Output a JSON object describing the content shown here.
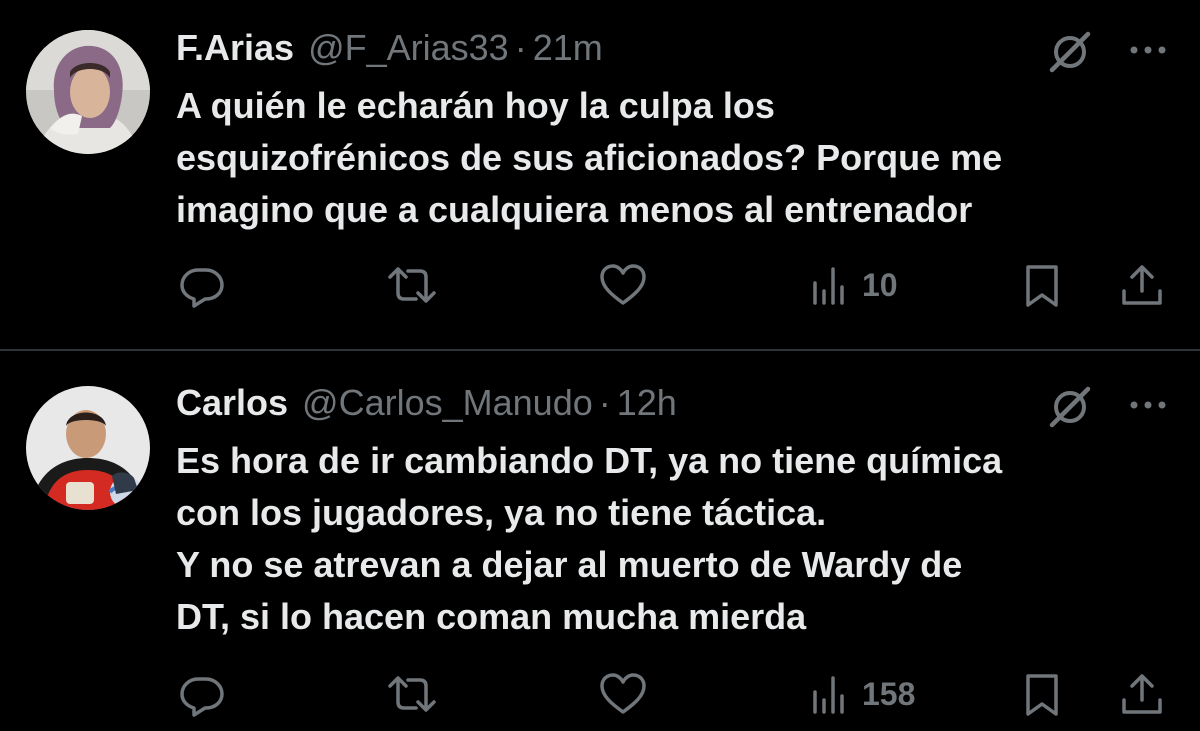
{
  "colors": {
    "background": "#000000",
    "text_primary": "#e7e9ea",
    "text_secondary": "#71767b",
    "divider": "#2f3336"
  },
  "tweets": [
    {
      "display_name": "F.Arias",
      "handle": "@F_Arias33",
      "separator": "·",
      "time": "21m",
      "text_lines": [
        "A quién le echarán hoy la culpa los",
        "esquizofrénicos de sus aficionados? Porque me",
        "imagino que a cualquiera menos al entrenador"
      ],
      "actions": {
        "reply_icon": "reply-icon",
        "retweet_icon": "retweet-icon",
        "like_icon": "heart-icon",
        "views_icon": "views-icon",
        "views_count": "10",
        "bookmark_icon": "bookmark-icon",
        "share_icon": "share-icon"
      }
    },
    {
      "display_name": "Carlos",
      "handle": "@Carlos_Manudo",
      "separator": "·",
      "time": "12h",
      "text_lines": [
        "Es hora de ir cambiando DT, ya no tiene química",
        "con los jugadores, ya no tiene táctica.",
        "Y no se atrevan a dejar al muerto de Wardy de",
        "DT, si lo hacen coman mucha mierda"
      ],
      "actions": {
        "reply_icon": "reply-icon",
        "retweet_icon": "retweet-icon",
        "like_icon": "heart-icon",
        "views_icon": "views-icon",
        "views_count": "158",
        "bookmark_icon": "bookmark-icon",
        "share_icon": "share-icon"
      }
    }
  ]
}
